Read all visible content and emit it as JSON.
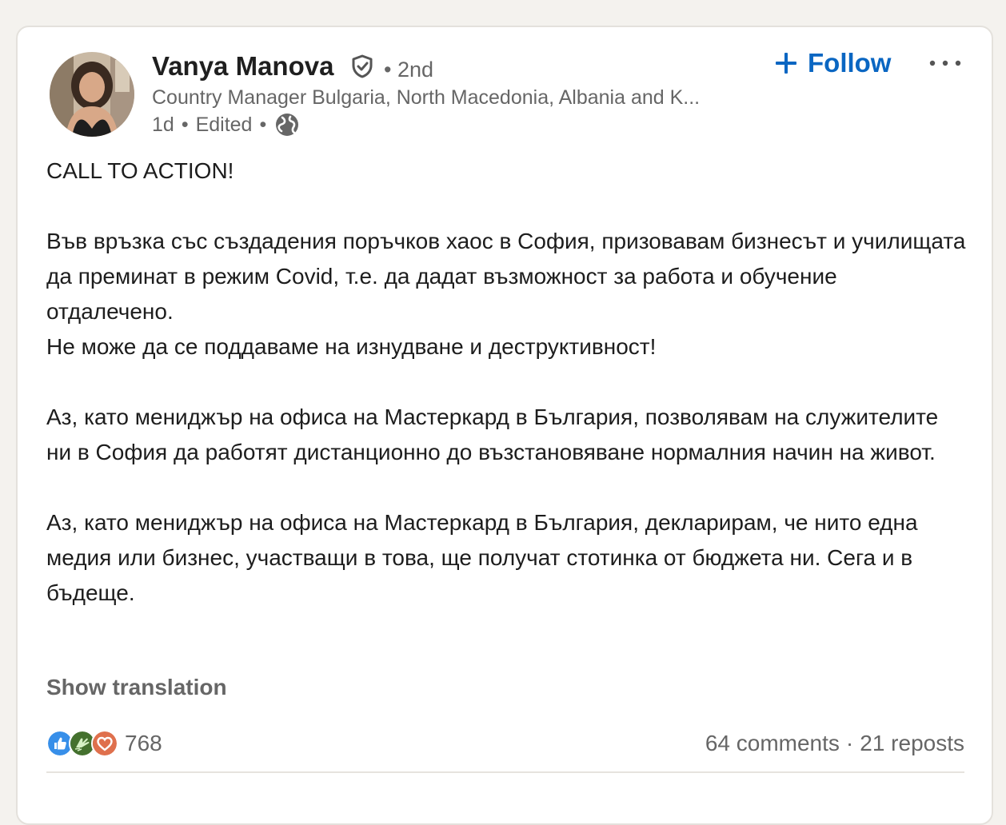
{
  "post": {
    "author": {
      "name": "Vanya Manova",
      "degree": "• 2nd",
      "headline": "Country Manager Bulgaria, North Macedonia, Albania and K...",
      "time": "1d",
      "edited": "Edited",
      "visibility_icon": "globe-icon",
      "verified_icon": "shield-check-icon"
    },
    "follow_label": "Follow",
    "more_icon": "ellipsis-icon",
    "body": {
      "p1": "CALL TO ACTION!",
      "p2": "Във връзка със създадения поръчков хаос в София, призовавам бизнесът и училищата да преминат в режим Covid, т.е. да дадат възможност за работа и обучение отдалечено.",
      "p3": "Не може да се поддаваме на изнудване и деструктивност!",
      "p4": "Аз, като мениджър на офиса на Мастеркард в България, позволявам на служителите ни в София да работят дистанционно до възстановяване нормалния начин на живот.",
      "p5": "Аз, като мениджър на офиса на Мастеркард в България, декларирам, че нито една медия или бизнес, участващи в това, ще получат стотинка от бюджета ни. Сега и в бъдеще."
    },
    "show_translation": "Show translation",
    "reactions": {
      "icons": [
        "like-icon",
        "celebrate-icon",
        "love-icon"
      ],
      "count": "768"
    },
    "comments": "64 comments",
    "reposts": "21 reposts",
    "separator": "·"
  },
  "colors": {
    "accent": "#0a66c2",
    "muted_text": "#666666",
    "body_text": "#1d1d1d",
    "like": "#378fe9",
    "celebrate": "#44712e",
    "love": "#df704d"
  }
}
